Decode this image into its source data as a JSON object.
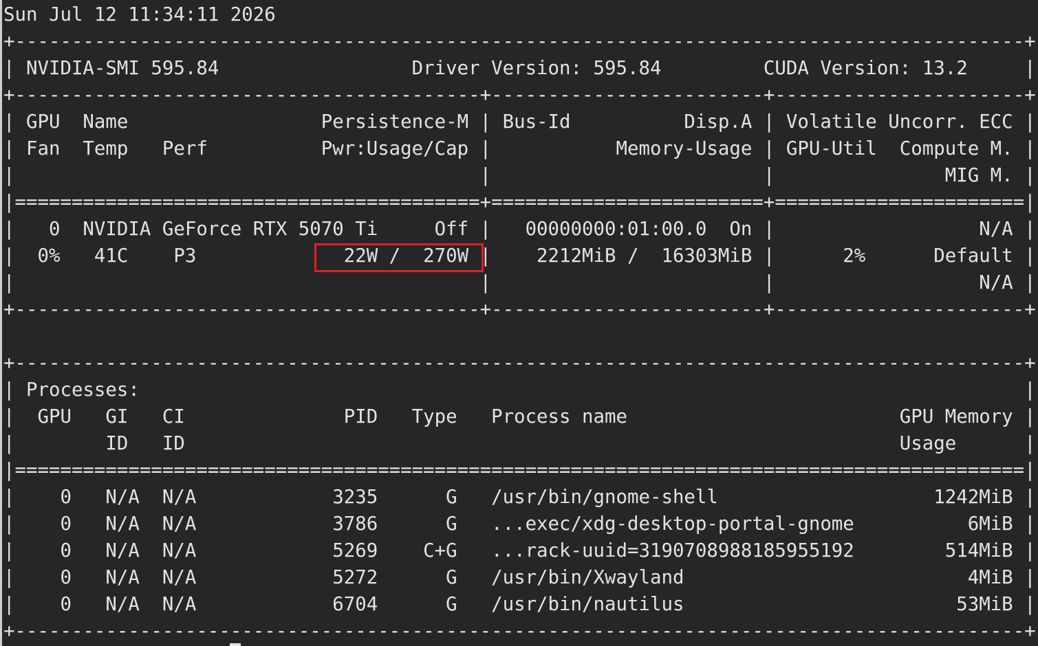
{
  "terminal": {
    "lines": [
      "Sun Jul 12 11:34:11 2026",
      "+-----------------------------------------------------------------------------------------+",
      "| NVIDIA-SMI 595.84                 Driver Version: 595.84         CUDA Version: 13.2     |",
      "+-----------------------------------------+------------------------+----------------------+",
      "| GPU  Name                 Persistence-M | Bus-Id          Disp.A | Volatile Uncorr. ECC |",
      "| Fan  Temp   Perf          Pwr:Usage/Cap |           Memory-Usage | GPU-Util  Compute M. |",
      "|                                         |                        |               MIG M. |",
      "|=========================================+========================+======================|",
      "|   0  NVIDIA GeForce RTX 5070 Ti     Off |   00000000:01:00.0  On |                  N/A |",
      "|  0%   41C    P3             22W /  270W |    2212MiB /  16303MiB |      2%      Default |",
      "|                                         |                        |                  N/A |",
      "+-----------------------------------------+------------------------+----------------------+",
      "",
      "+-----------------------------------------------------------------------------------------+",
      "| Processes:                                                                              |",
      "|  GPU   GI   CI              PID   Type   Process name                        GPU Memory |",
      "|        ID   ID                                                               Usage      |",
      "|=========================================================================================|",
      "|    0   N/A  N/A            3235      G   /usr/bin/gnome-shell                   1242MiB |",
      "|    0   N/A  N/A            3786      G   ...exec/xdg-desktop-portal-gnome          6MiB |",
      "|    0   N/A  N/A            5269    C+G   ...rack-uuid=3190708988185955192        514MiB |",
      "|    0   N/A  N/A            5272      G   /usr/bin/Xwayland                         4MiB |",
      "|    0   N/A  N/A            6704      G   /usr/bin/nautilus                        53MiB |",
      "+-----------------------------------------------------------------------------------------+"
    ]
  },
  "colors": {
    "background": "#262626",
    "text": "#e3e3e3",
    "highlight": "#e01f27"
  }
}
